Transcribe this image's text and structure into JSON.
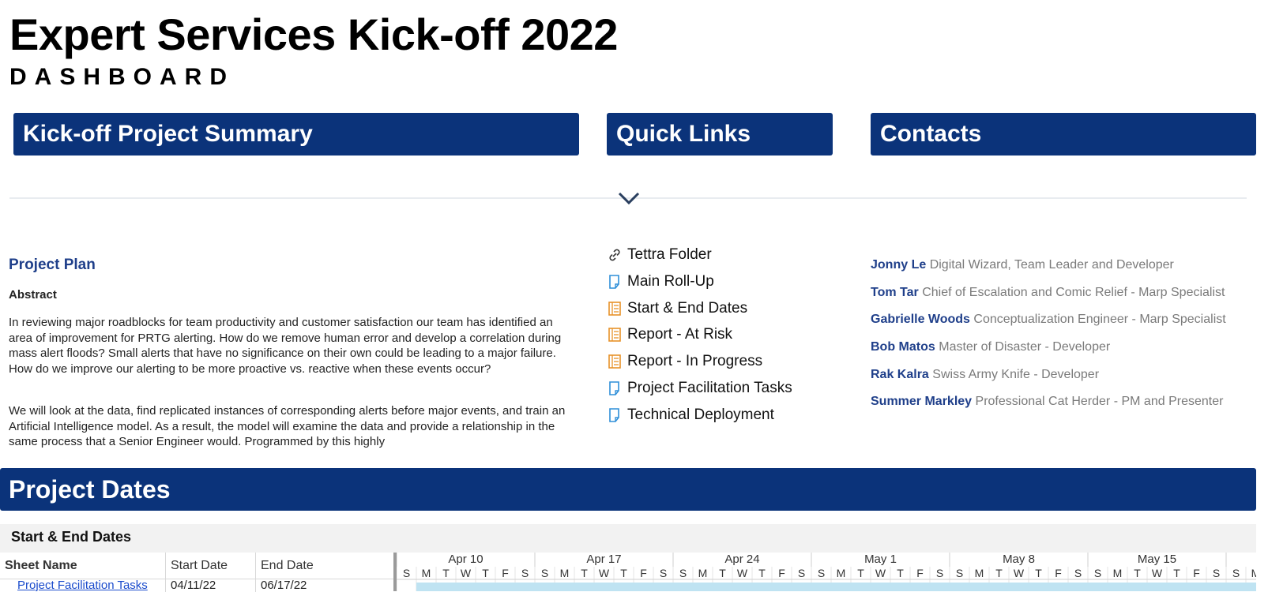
{
  "header": {
    "title": "Expert Services Kick-off 2022",
    "subtitle": "DASHBOARD"
  },
  "sections": {
    "summary": "Kick-off Project Summary",
    "quick_links": "Quick Links",
    "contacts": "Contacts",
    "project_dates": "Project Dates"
  },
  "summary": {
    "plan_title": "Project Plan",
    "abstract_label": "Abstract",
    "paragraph1": "In reviewing major roadblocks for team productivity and customer satisfaction our team has identified an area of improvement for PRTG alerting. How do we remove human error and develop a correlation during mass alert floods? Small alerts that have no significance on their own could be leading to a major failure. How do we improve our alerting to be more proactive vs. reactive when these events occur?",
    "paragraph2": "We will look at the data, find replicated instances of corresponding alerts before major events, and train an Artificial Intelligence model. As a result, the model will examine the data and provide a relationship in the same process that a Senior Engineer would. Programmed by this highly"
  },
  "quick_links": [
    {
      "label": "Tettra Folder",
      "icon": "link-icon"
    },
    {
      "label": "Main Roll-Up",
      "icon": "sheet-icon"
    },
    {
      "label": "Start & End Dates",
      "icon": "report-icon"
    },
    {
      "label": "Report - At Risk",
      "icon": "report-icon"
    },
    {
      "label": "Report - In Progress",
      "icon": "report-icon"
    },
    {
      "label": "Project Facilitation Tasks",
      "icon": "sheet-icon"
    },
    {
      "label": "Technical Deployment",
      "icon": "sheet-icon"
    }
  ],
  "contacts": [
    {
      "name": "Jonny Le",
      "role": "Digital Wizard, Team Leader and Developer"
    },
    {
      "name": "Tom Tar",
      "role": "Chief of Escalation and Comic Relief - Marp Specialist"
    },
    {
      "name": "Gabrielle Woods",
      "role": "Conceptualization Engineer - Marp Specialist"
    },
    {
      "name": "Bob Matos",
      "role": "Master of Disaster - Developer"
    },
    {
      "name": "Rak Kalra",
      "role": "Swiss Army Knife - Developer"
    },
    {
      "name": "Summer Markley",
      "role": "Professional Cat Herder - PM and Presenter"
    }
  ],
  "gantt": {
    "title": "Start & End Dates",
    "columns": {
      "sheet_name": "Sheet Name",
      "start_date": "Start Date",
      "end_date": "End Date"
    },
    "weeks": [
      "Apr 10",
      "Apr 17",
      "Apr 24",
      "May 1",
      "May 8",
      "May 15"
    ],
    "day_letters": [
      "S",
      "M",
      "T",
      "W",
      "T",
      "F",
      "S"
    ],
    "rows": [
      {
        "sheet_name": "Project Facilitation Tasks",
        "start_date": "04/11/22",
        "end_date": "06/17/22"
      }
    ]
  },
  "colors": {
    "header_bar": "#0b337a",
    "contact_name": "#1f3f8a",
    "link_blue": "#1a4bcc",
    "gantt_bar": "#bfe3f2",
    "sheet_icon": "#2f8fd8",
    "report_icon": "#e8922a"
  }
}
